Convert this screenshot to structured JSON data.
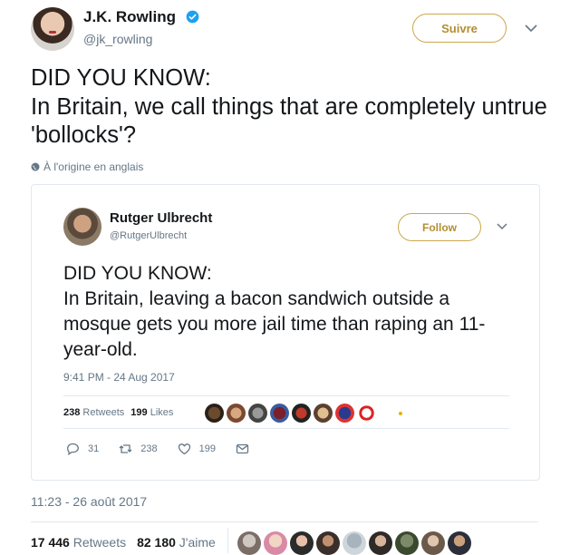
{
  "author": {
    "name": "J.K. Rowling",
    "handle": "@jk_rowling",
    "verified_icon": "verified-badge-icon",
    "follow_label": "Suivre"
  },
  "tweet": {
    "text": "DID YOU KNOW:\nIn Britain, we call things that are completely untrue 'bollocks'?",
    "translation_note": "À l'origine en anglais",
    "timestamp": "11:23 - 26 août 2017",
    "retweets_count": "17 446",
    "retweets_label": "Retweets",
    "likes_count": "82 180",
    "likes_label": "J'aime"
  },
  "quoted": {
    "name": "Rutger Ulbrecht",
    "handle": "@RutgerUlbrecht",
    "follow_label": "Follow",
    "text": "DID YOU KNOW:\nIn Britain, leaving a bacon sandwich outside a mosque gets you more jail time than raping an 11-year-old.",
    "timestamp": "9:41 PM - 24 Aug 2017",
    "retweets_count": "238",
    "retweets_label": "Retweets",
    "likes_count": "199",
    "likes_label": "Likes",
    "actions": {
      "reply_count": "31",
      "retweet_count": "238",
      "like_count": "199"
    }
  },
  "colors": {
    "follow_accent": "#b28e34",
    "verified_blue": "#1da1f2",
    "muted_text": "#657786"
  }
}
